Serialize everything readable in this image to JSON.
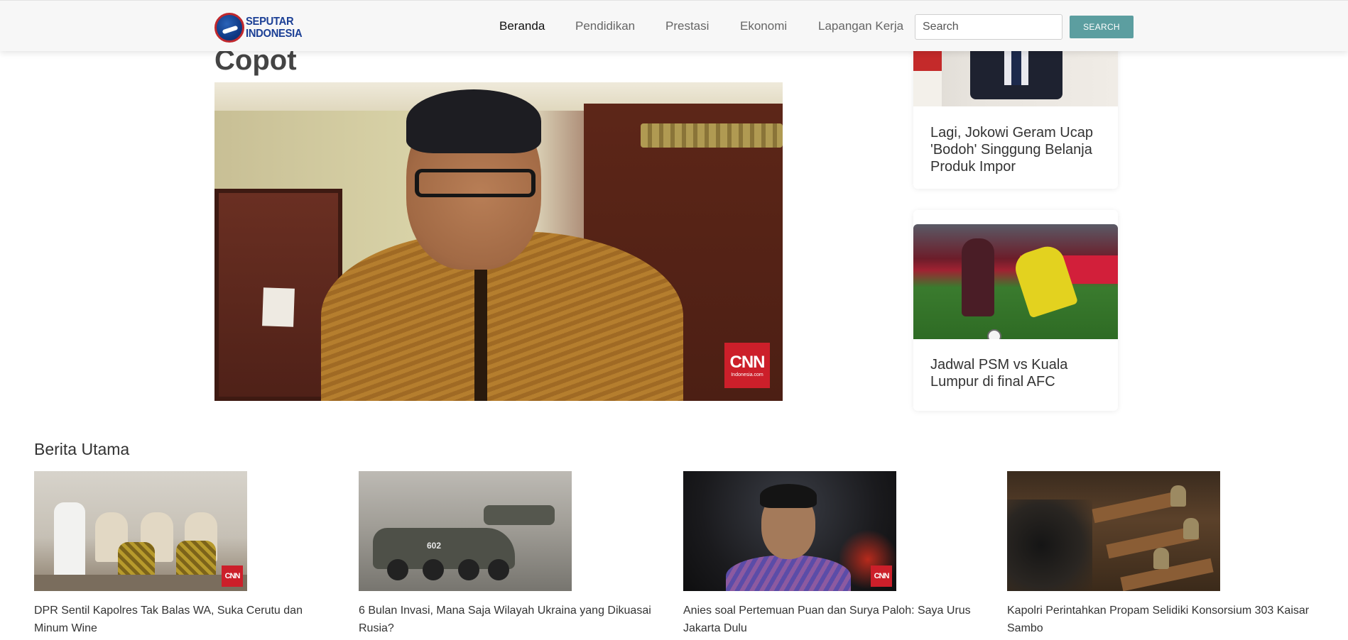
{
  "header": {
    "logo_line1": "SEPUTAR",
    "logo_line2": "INDONESIA",
    "nav": [
      {
        "label": "Beranda",
        "active": true
      },
      {
        "label": "Pendidikan",
        "active": false
      },
      {
        "label": "Prestasi",
        "active": false
      },
      {
        "label": "Ekonomi",
        "active": false
      },
      {
        "label": "Lapangan Kerja",
        "active": false
      }
    ],
    "search": {
      "placeholder": "Search",
      "button_label": "SEARCH"
    },
    "colors": {
      "logo_blue": "#1b3f95",
      "search_button": "#5c9ea0"
    }
  },
  "article": {
    "title_fragment": "Copot",
    "image_badge": {
      "word": "CNN",
      "sub": "Indonesia.com"
    }
  },
  "sidebar": {
    "cards": [
      {
        "title": "Lagi, Jokowi Geram Ucap 'Bodoh' Singgung Belanja Produk Impor"
      },
      {
        "title": "Jadwal PSM vs Kuala Lumpur di final AFC"
      }
    ]
  },
  "berita_utama": {
    "heading": "Berita Utama",
    "items": [
      {
        "caption": "DPR Sentil Kapolres Tak Balas WA, Suka Cerutu dan Minum Wine",
        "badge": "CNN"
      },
      {
        "caption": "6 Bulan Invasi, Mana Saja Wilayah Ukraina yang Dikuasai Rusia?",
        "vehicle_label": "602"
      },
      {
        "caption": "Anies soal Pertemuan Puan dan Surya Paloh: Saya Urus Jakarta Dulu",
        "badge": "CNN"
      },
      {
        "caption": "Kapolri Perintahkan Propam Selidiki Konsorsium 303 Kaisar Sambo"
      }
    ]
  }
}
